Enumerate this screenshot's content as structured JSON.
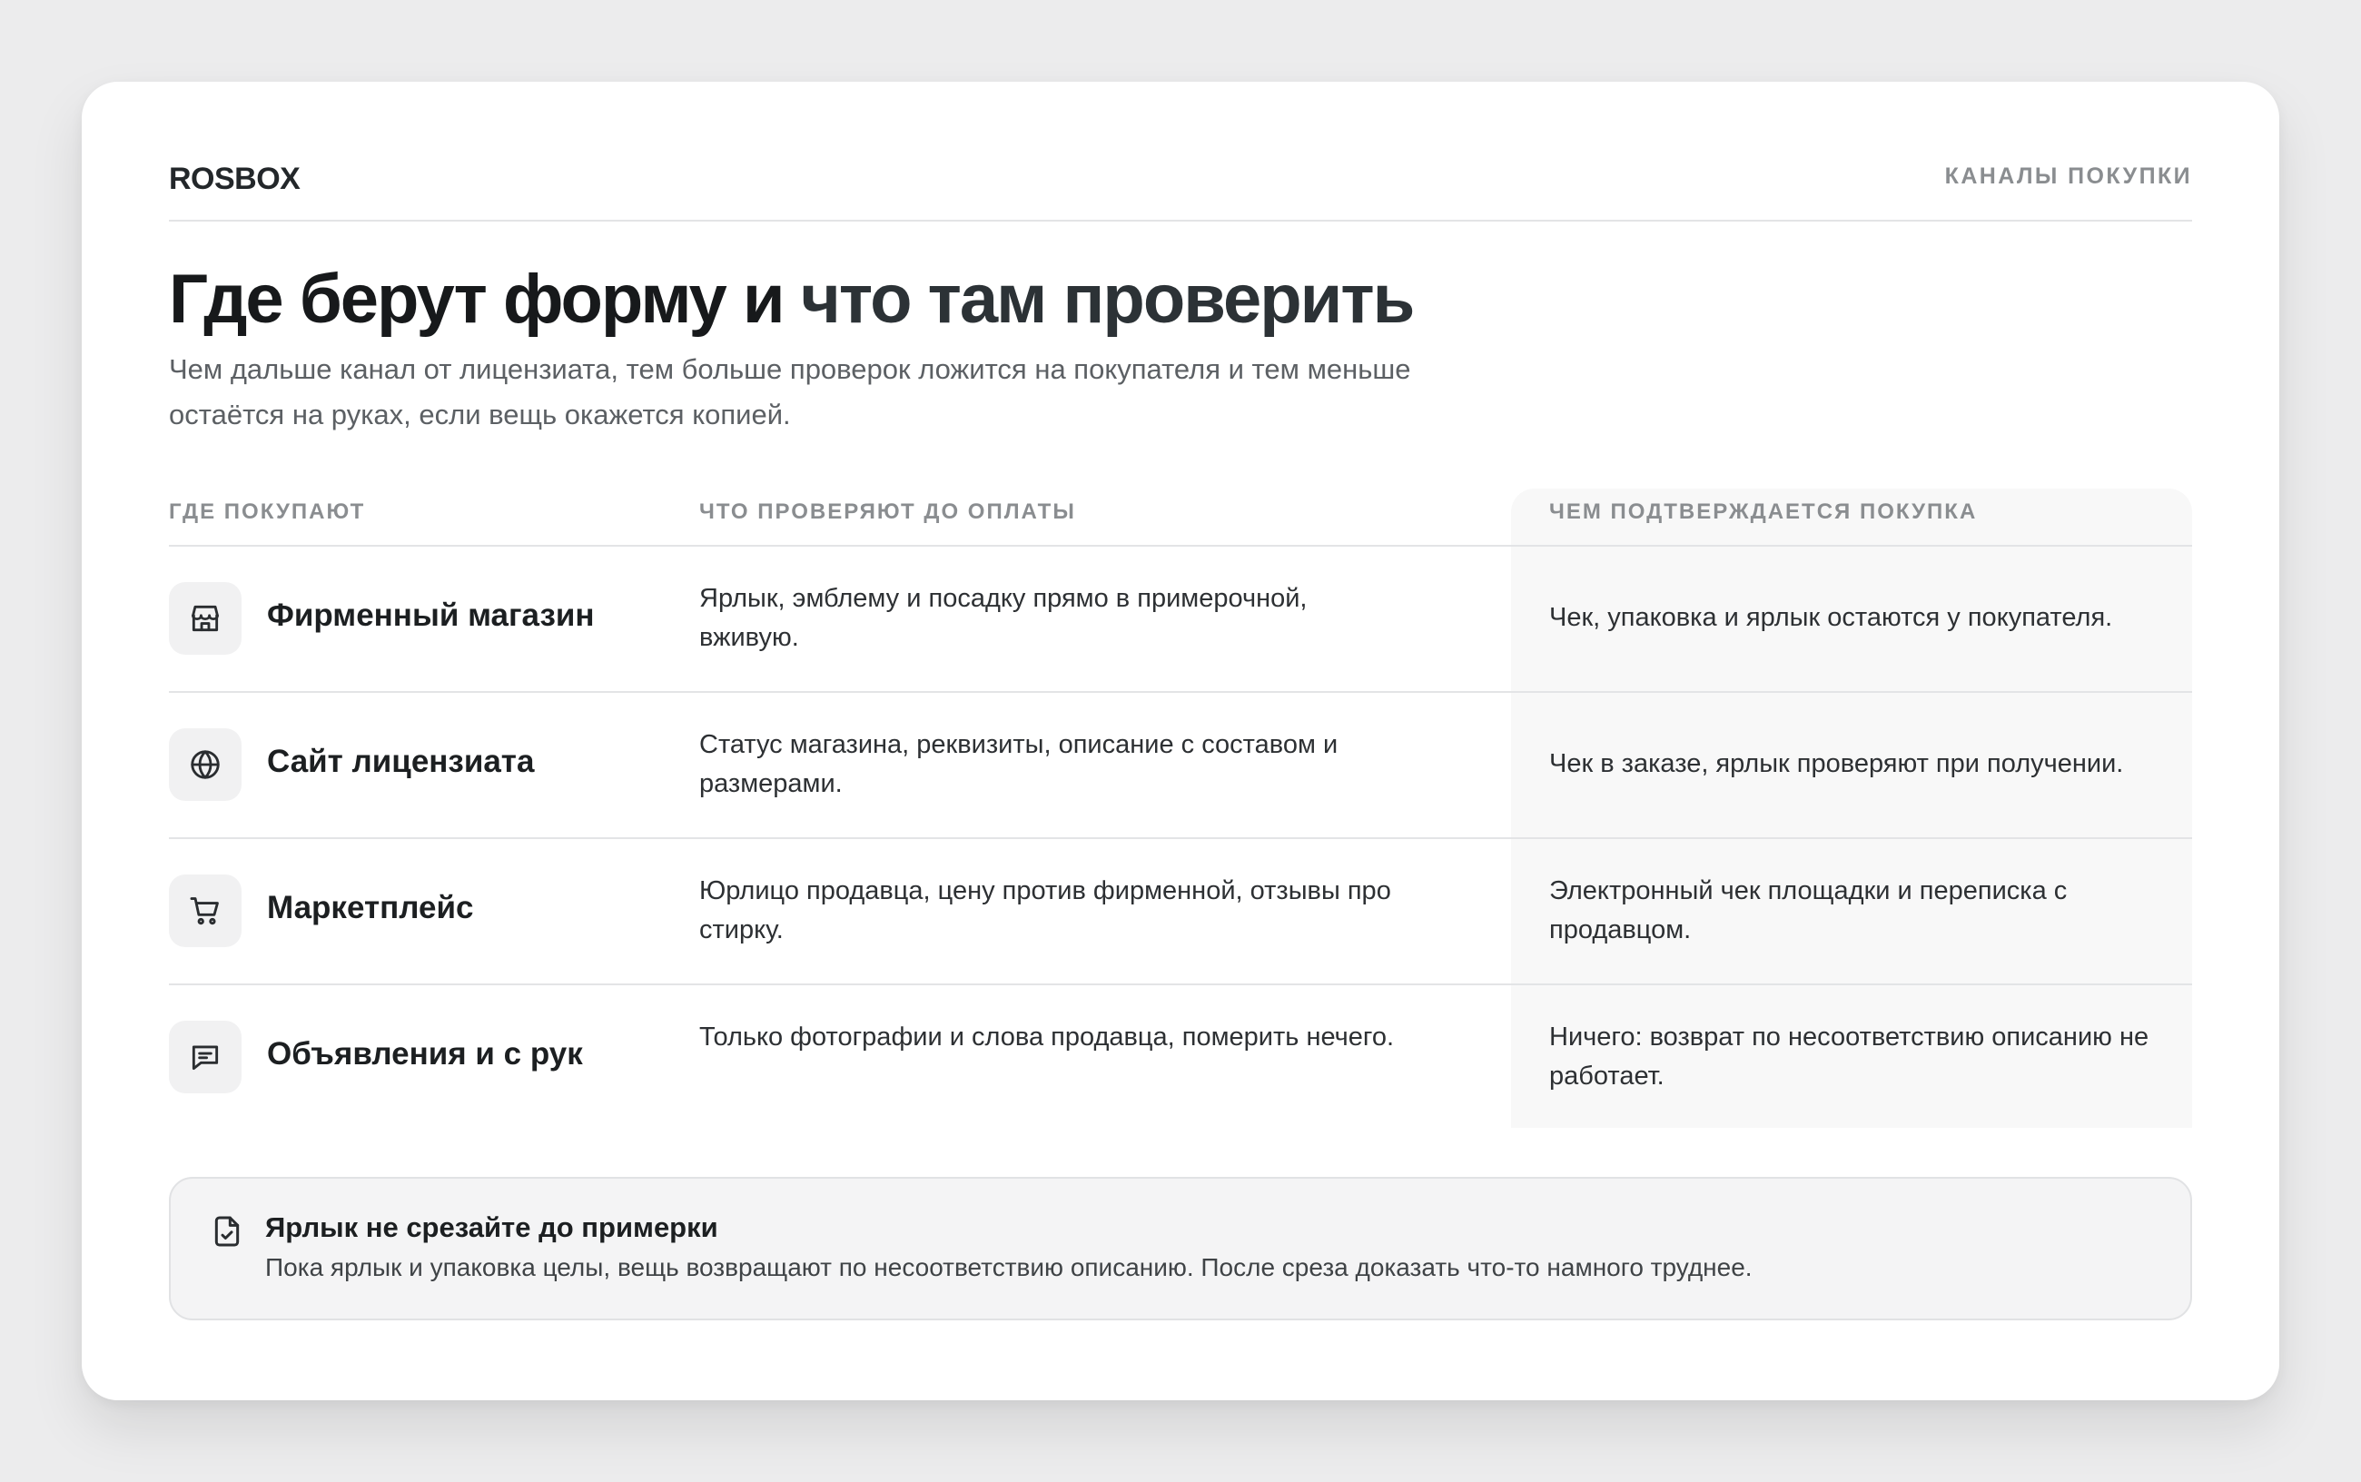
{
  "header": {
    "brand": "ROSBOX",
    "section_label": "КАНАЛЫ ПОКУПКИ"
  },
  "hero": {
    "title_part1": "Где берут форму и",
    "title_part2": "что там проверить",
    "subtitle": "Чем дальше канал от лицензиата, тем больше проверок ложится на покупателя и тем меньше остаётся на руках, если вещь окажется копией."
  },
  "table": {
    "headers": [
      "ГДЕ ПОКУПАЮТ",
      "ЧТО ПРОВЕРЯЮТ ДО ОПЛАТЫ",
      "ЧЕМ ПОДТВЕРЖДАЕТСЯ ПОКУПКА"
    ],
    "rows": [
      {
        "icon": "store-icon",
        "channel": "Фирменный магазин",
        "check": "Ярлык, эмблему и посадку прямо в примерочной, вживую.",
        "confirm": "Чек, упаковка и ярлык остаются у покупателя."
      },
      {
        "icon": "globe-icon",
        "channel": "Сайт лицензиата",
        "check": "Статус магазина, реквизиты, описание с составом и размерами.",
        "confirm": "Чек в заказе, ярлык проверяют при получении."
      },
      {
        "icon": "cart-icon",
        "channel": "Маркетплейс",
        "check": "Юрлицо продавца, цену против фирменной, отзывы про стирку.",
        "confirm": "Электронный чек площадки и переписка с продавцом."
      },
      {
        "icon": "message-icon",
        "channel": "Объявления и с рук",
        "check": "Только фотографии и слова продавца, померить нечего.",
        "confirm": "Ничего: возврат по несоответствию описанию не работает."
      }
    ]
  },
  "note": {
    "icon": "file-check-icon",
    "title": "Ярлык не срезайте до примерки",
    "text": "Пока ярлык и упаковка целы, вещь возвращают по несоответствию описанию. После среза доказать что-то намного труднее."
  }
}
